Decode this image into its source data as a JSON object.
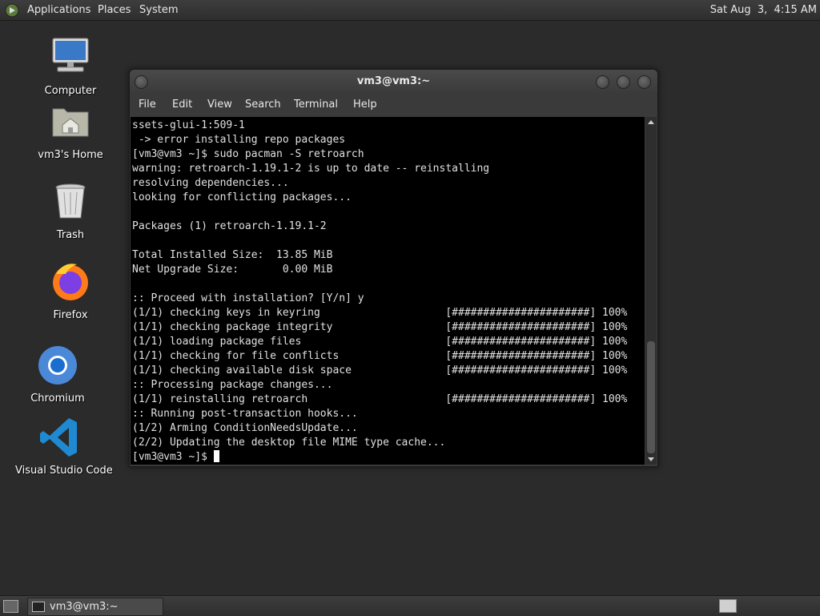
{
  "top_panel": {
    "menus": [
      "Applications",
      "Places",
      "System"
    ],
    "clock": "Sat Aug  3,  4:15 AM"
  },
  "desktop_icons": [
    {
      "label": "Computer",
      "icon": "computer-icon"
    },
    {
      "label": "vm3's Home",
      "icon": "home-folder-icon"
    },
    {
      "label": "Trash",
      "icon": "trash-icon"
    },
    {
      "label": "Firefox",
      "icon": "firefox-icon"
    },
    {
      "label": "Chromium",
      "icon": "chromium-icon"
    },
    {
      "label": "Visual Studio Code",
      "icon": "vscode-icon"
    }
  ],
  "terminal": {
    "title": "vm3@vm3:~",
    "menu": [
      "File",
      "Edit",
      "View",
      "Search",
      "Terminal",
      "Help"
    ],
    "lines": [
      "ssets-glui-1:509-1",
      " -> error installing repo packages",
      "[vm3@vm3 ~]$ sudo pacman -S retroarch",
      "warning: retroarch-1.19.1-2 is up to date -- reinstalling",
      "resolving dependencies...",
      "looking for conflicting packages...",
      "",
      "Packages (1) retroarch-1.19.1-2",
      "",
      "Total Installed Size:  13.85 MiB",
      "Net Upgrade Size:       0.00 MiB",
      "",
      ":: Proceed with installation? [Y/n] y",
      "(1/1) checking keys in keyring                    [######################] 100%",
      "(1/1) checking package integrity                  [######################] 100%",
      "(1/1) loading package files                       [######################] 100%",
      "(1/1) checking for file conflicts                 [######################] 100%",
      "(1/1) checking available disk space               [######################] 100%",
      ":: Processing package changes...",
      "(1/1) reinstalling retroarch                      [######################] 100%",
      ":: Running post-transaction hooks...",
      "(1/2) Arming ConditionNeedsUpdate...",
      "(2/2) Updating the desktop file MIME type cache...",
      "[vm3@vm3 ~]$ "
    ]
  },
  "taskbar": {
    "task_label": "vm3@vm3:~"
  }
}
